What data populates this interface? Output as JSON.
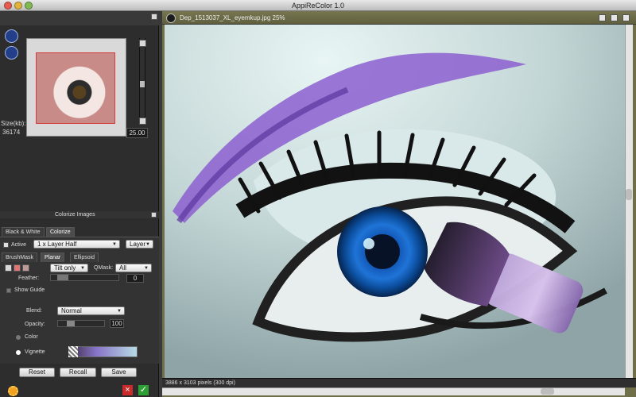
{
  "window": {
    "title": "AppiReColor 1.0",
    "controls": {
      "close_color": "#e65b4f",
      "minimize_color": "#e0b43b",
      "zoom_color": "#80b950"
    }
  },
  "thumbnail": {
    "size_label": "Size(kb):",
    "size_value": "36174",
    "zoom_value": "25.00"
  },
  "colorize": {
    "section_title": "Colorize Images",
    "tabs": [
      "Black & White",
      "Colorize"
    ],
    "active_label": "Active",
    "layer_value": "1  x Layer Half",
    "layer_button": "Layer",
    "mask_tabs": [
      "BrushMask",
      "Planar",
      "Ellipsoid"
    ],
    "tilt_value": "Tilt only",
    "qmask_label": "QMask:",
    "qmask_value": "All",
    "feather_label": "Feather:",
    "feather_value": "0",
    "show_guide": "Show Guide",
    "blend_label": "Blend:",
    "blend_value": "Normal",
    "opacity_label": "Opacity:",
    "opacity_value": "100",
    "color_label": "Color",
    "vignette_label": "Vignette",
    "buttons": {
      "reset": "Reset",
      "recall": "Recall",
      "save": "Save"
    }
  },
  "document": {
    "tab_title": "Dep_1513037_XL_eyemkup.jpg 25%",
    "status": "3886 x 3103 pixels (300 dpi)"
  },
  "icons": {
    "zoom_in": "zoom-in-icon",
    "zoom_out": "zoom-out-icon",
    "settings": "gear-icon",
    "cancel": "cancel-icon",
    "confirm": "check-icon"
  },
  "colors": {
    "accent": "#7d5fc8",
    "iris": "#1f74d7",
    "brush": "#b8a1d6"
  }
}
